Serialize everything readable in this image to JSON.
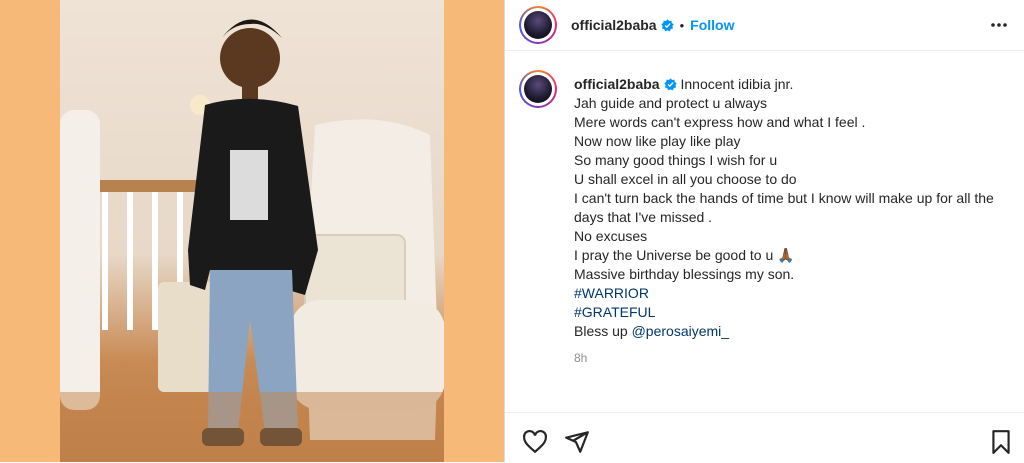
{
  "post": {
    "username": "official2baba",
    "follow_label": "Follow",
    "dot": "•",
    "caption_lines": [
      "Innocent idibia jnr.",
      "Jah guide and protect u always",
      "Mere words can't express how and what I feel .",
      "Now now like play like play",
      "So many good things I wish for u",
      "U shall excel in all you choose to do",
      "I can't turn back the hands of time but I know will make up for all the days that I've missed .",
      "No excuses",
      "I pray the Universe be good to u 🙏🏾",
      "Massive birthday blessings my son."
    ],
    "hashtags": [
      "#WARRIOR",
      "#GRATEFUL"
    ],
    "bless_prefix": "Bless up ",
    "mention": "@perosaiyemi_",
    "time": "8h"
  },
  "icons": [
    "verified-badge-icon",
    "more-options-icon",
    "heart-icon",
    "share-icon",
    "bookmark-icon"
  ],
  "colors": {
    "follow": "#0095f6",
    "hashtag": "#00376b",
    "verified": "#0095f6",
    "photo_bg": "#f6b977"
  }
}
